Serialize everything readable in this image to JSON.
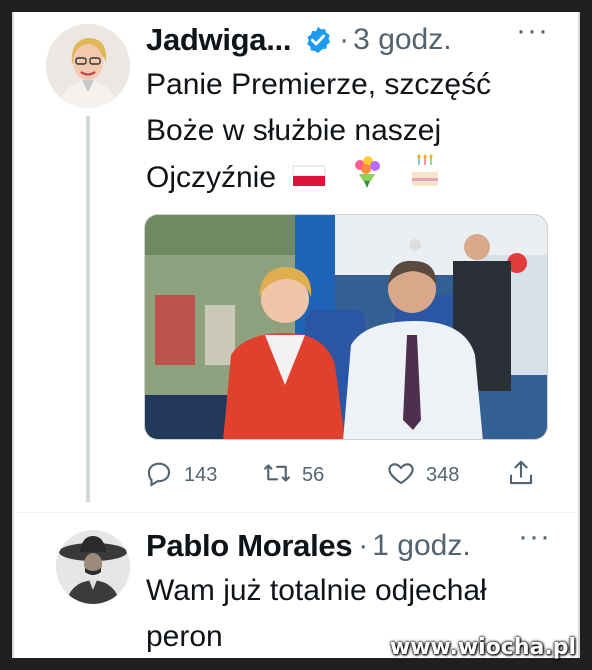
{
  "tweet1": {
    "author_name": "Jadwiga...",
    "verified_icon": "verified-badge-icon",
    "separator": "·",
    "time": "3 godz.",
    "more": "···",
    "text_line1": "Panie Premierze, szczęść",
    "text_line2": "Boże w służbie naszej",
    "text_line3": "Ojczyźnie",
    "emojis": [
      "poland-flag-icon",
      "bouquet-icon",
      "birthday-cake-icon"
    ],
    "actions": {
      "reply_count": "143",
      "retweet_count": "56",
      "like_count": "348"
    }
  },
  "tweet2": {
    "author_name": "Pablo Morales",
    "separator": "·",
    "time": "1 godz.",
    "more": "···",
    "text_line1": "Wam już totalnie odjechał",
    "text_line2": "peron"
  },
  "watermark": "www.wiocha.pl",
  "colors": {
    "verified": "#1d9bf0",
    "secondary_text": "#536471",
    "primary_text": "#0f1419"
  }
}
